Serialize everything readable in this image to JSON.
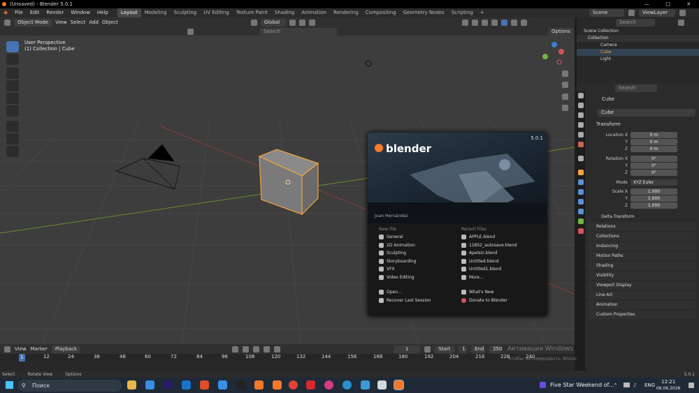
{
  "window": {
    "title": "(Unsaved) - Blender 5.0.1",
    "controls": [
      "minimize-icon",
      "maximize-icon",
      "close-icon"
    ]
  },
  "menu": {
    "items": [
      "File",
      "Edit",
      "Render",
      "Window",
      "Help"
    ],
    "workspaces": [
      "Layout",
      "Modeling",
      "Sculpting",
      "UV Editing",
      "Texture Paint",
      "Shading",
      "Animation",
      "Rendering",
      "Compositing",
      "Geometry Nodes",
      "Scripting"
    ],
    "active_workspace": "Layout",
    "add": "+",
    "scene": "Scene",
    "view_layer": "ViewLayer"
  },
  "viewport": {
    "mode": "Object Mode",
    "menus": [
      "View",
      "Select",
      "Add",
      "Object"
    ],
    "orientation": "Global",
    "search_placeholder": "Search",
    "options": "Options",
    "perspective": "User Perspective",
    "collection": "(1) Collection | Cube"
  },
  "splash": {
    "brand": "blender",
    "version": "5.0.1",
    "credit": "Juan Hernández",
    "new_file_heading": "New File",
    "new_file": [
      "General",
      "2D Animation",
      "Sculpting",
      "Storyboarding",
      "VFX",
      "Video Editing"
    ],
    "recent_heading": "Recent Files",
    "recent": [
      "APPLE.blend",
      "11852_autosave.blend",
      "Apelsin.blend",
      "Untitled.blend",
      "Untitled1.blend",
      "More..."
    ],
    "open": "Open...",
    "recover": "Recover Last Session",
    "whats_new": "What's New",
    "donate": "Donate to Blender"
  },
  "timeline": {
    "menus": [
      "View",
      "Marker",
      "Playback"
    ],
    "current_frame": "1",
    "start_label": "Start",
    "start_value": "1",
    "end_label": "End",
    "end_value": "250",
    "ruler": [
      "1",
      "12",
      "24",
      "36",
      "48",
      "60",
      "72",
      "84",
      "96",
      "108",
      "120",
      "132",
      "144",
      "156",
      "168",
      "180",
      "192",
      "204",
      "216",
      "228",
      "240"
    ]
  },
  "statusbar": {
    "items": [
      "Select",
      "Rotate View",
      "Options"
    ],
    "version": "5.0.1"
  },
  "outliner": {
    "search_placeholder": "Search",
    "scene_collection": "Scene Collection",
    "collection": "Collection",
    "objects": [
      "Camera",
      "Cube",
      "Light"
    ]
  },
  "properties": {
    "search_placeholder": "Search",
    "object_name": "Cube",
    "data_name": "Cube",
    "transform_heading": "Transform",
    "location_label": "Location X",
    "location": [
      "0 m",
      "0 m",
      "0 m"
    ],
    "rotation_label": "Rotation X",
    "rotation": [
      "0°",
      "0°",
      "0°"
    ],
    "mode_label": "Mode",
    "mode_value": "XYZ Euler",
    "scale_label": "Scale X",
    "scale": [
      "1.000",
      "1.000",
      "1.000"
    ],
    "y_label": "Y",
    "z_label": "Z",
    "delta": "Delta Transform",
    "panels": [
      "Relations",
      "Collections",
      "Instancing",
      "Motion Paths",
      "Shading",
      "Visibility",
      "Viewport Display",
      "Line Art",
      "Animation",
      "Custom Properties"
    ]
  },
  "taskbar": {
    "search": "Поиск",
    "notification": "Five Star Weekend of...",
    "lang": "ENG",
    "time": "12:21",
    "date": "06.06.2026"
  },
  "watermark": {
    "line1": "Активация Windows",
    "line2": "Чтобы активировать Windows, перейдите в раздел \"Параметры\"."
  },
  "colors": {
    "accent": "#4772b3",
    "selection": "#f3a33f",
    "xaxis": "#8f3d3d",
    "yaxis": "#6a8c2f"
  }
}
